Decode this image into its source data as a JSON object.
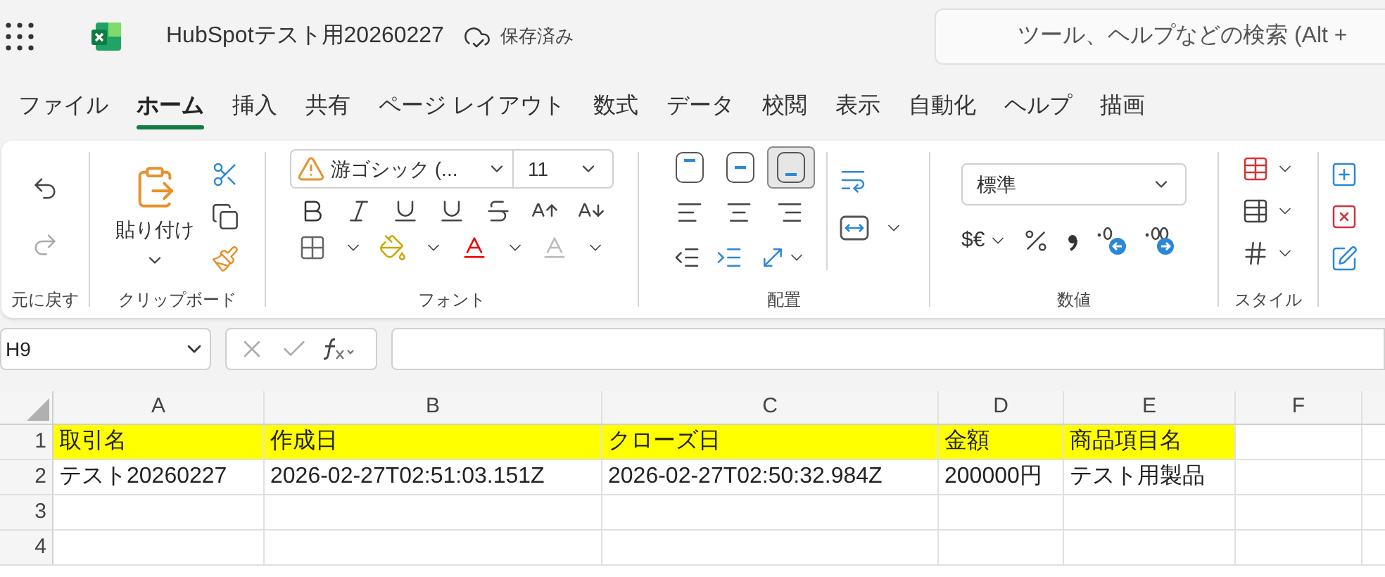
{
  "app": {
    "title": "HubSpotテスト用20260227",
    "save_status": "保存済み",
    "search_placeholder": "ツール、ヘルプなどの検索 (Alt +"
  },
  "tabs": [
    {
      "label": "ファイル",
      "selected": false
    },
    {
      "label": "ホーム",
      "selected": true
    },
    {
      "label": "挿入",
      "selected": false
    },
    {
      "label": "共有",
      "selected": false
    },
    {
      "label": "ページ レイアウト",
      "selected": false
    },
    {
      "label": "数式",
      "selected": false
    },
    {
      "label": "データ",
      "selected": false
    },
    {
      "label": "校閲",
      "selected": false
    },
    {
      "label": "表示",
      "selected": false
    },
    {
      "label": "自動化",
      "selected": false
    },
    {
      "label": "ヘルプ",
      "selected": false
    },
    {
      "label": "描画",
      "selected": false
    }
  ],
  "ribbon": {
    "undo": {
      "label": "元に戻す"
    },
    "clipboard": {
      "paste_label": "貼り付け",
      "label": "クリップボード"
    },
    "font": {
      "name": "游ゴシック (...",
      "size": "11",
      "label": "フォント"
    },
    "alignment": {
      "vertical": [
        {
          "kind": "top",
          "selected": false
        },
        {
          "kind": "middle",
          "selected": false
        },
        {
          "kind": "bottom",
          "selected": true
        }
      ],
      "label": "配置"
    },
    "number": {
      "format": "標準",
      "currency": "$€",
      "label": "数値"
    },
    "styles": {
      "label": "スタイル"
    }
  },
  "sheet": {
    "name_box": "H9",
    "columns": [
      "A",
      "B",
      "C",
      "D",
      "E",
      "F"
    ],
    "rows": [
      {
        "number": "1",
        "filled": true,
        "cells": [
          "取引名",
          "作成日",
          "クローズ日",
          "金額",
          "商品項目名"
        ]
      },
      {
        "number": "2",
        "filled": false,
        "cells": [
          "テスト20260227",
          "2026-02-27T02:51:03.151Z",
          "2026-02-27T02:50:32.984Z",
          "200000円",
          "テスト用製品"
        ]
      },
      {
        "number": "3"
      },
      {
        "number": "4"
      }
    ]
  }
}
